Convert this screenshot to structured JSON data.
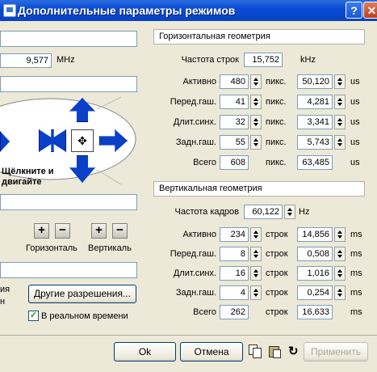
{
  "window": {
    "title": "Дополнительные параметры режимов",
    "help": "?",
    "close": "✕"
  },
  "left": {
    "pixel_clock": "9,577",
    "pixel_clock_unit": "MHz",
    "move_hint_line1": "Щёлкните и",
    "move_hint_line2": "двигайте",
    "horizontal_label": "Горизонталь",
    "vertical_label": "Вертикаль",
    "plus": "+",
    "minus": "−",
    "partial_text_1": "ия",
    "partial_text_2": "н",
    "other_resolutions": "Другие разрешения...",
    "realtime_label": "В реальном времени",
    "realtime_checked": true
  },
  "hgeom": {
    "header": "Горизонтальная геометрия",
    "freq_label": "Частота строк",
    "freq_value": "15,752",
    "freq_unit": "kHz",
    "rows": [
      {
        "label": "Активно",
        "value": "480",
        "unit": "пикс.",
        "time": "50,120",
        "tunit": "us",
        "spin": true
      },
      {
        "label": "Перед.гаш.",
        "value": "41",
        "unit": "пикс.",
        "time": "4,281",
        "tunit": "us",
        "spin": true
      },
      {
        "label": "Длит.синх.",
        "value": "32",
        "unit": "пикс.",
        "time": "3,341",
        "tunit": "us",
        "spin": true
      },
      {
        "label": "Задн.гаш.",
        "value": "55",
        "unit": "пикс.",
        "time": "5,743",
        "tunit": "us",
        "spin": true
      },
      {
        "label": "Всего",
        "value": "608",
        "unit": "пикс.",
        "time": "63,485",
        "tunit": "us",
        "spin": false
      }
    ]
  },
  "vgeom": {
    "header": "Вертикальная геометрия",
    "freq_label": "Частота кадров",
    "freq_value": "60,122",
    "freq_unit": "Hz",
    "rows": [
      {
        "label": "Активно",
        "value": "234",
        "unit": "строк",
        "time": "14,856",
        "tunit": "ms",
        "spin": true
      },
      {
        "label": "Перед.гаш.",
        "value": "8",
        "unit": "строк",
        "time": "0,508",
        "tunit": "ms",
        "spin": true
      },
      {
        "label": "Длит.синх.",
        "value": "16",
        "unit": "строк",
        "time": "1,016",
        "tunit": "ms",
        "spin": true
      },
      {
        "label": "Задн.гаш.",
        "value": "4",
        "unit": "строк",
        "time": "0,254",
        "tunit": "ms",
        "spin": true
      },
      {
        "label": "Всего",
        "value": "262",
        "unit": "строк",
        "time": "16,633",
        "tunit": "ms",
        "spin": false
      }
    ]
  },
  "buttons": {
    "ok": "Ok",
    "cancel": "Отмена",
    "apply": "Применить"
  },
  "icons": [
    "copy-icon",
    "paste-icon",
    "refresh-icon"
  ]
}
